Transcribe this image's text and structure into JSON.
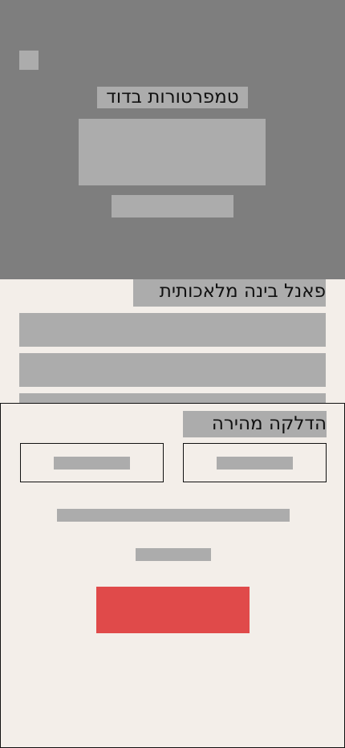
{
  "header": {
    "title": "טמפרטורות בדוד"
  },
  "ai_panel": {
    "title": "פאנל בינה מלאכותית"
  },
  "quick_ignite": {
    "title": "הדלקה מהירה"
  },
  "colors": {
    "header_bg": "#7e7e7e",
    "page_bg": "#f3eee9",
    "placeholder": "#acacac",
    "primary_action": "#e04a4a"
  }
}
